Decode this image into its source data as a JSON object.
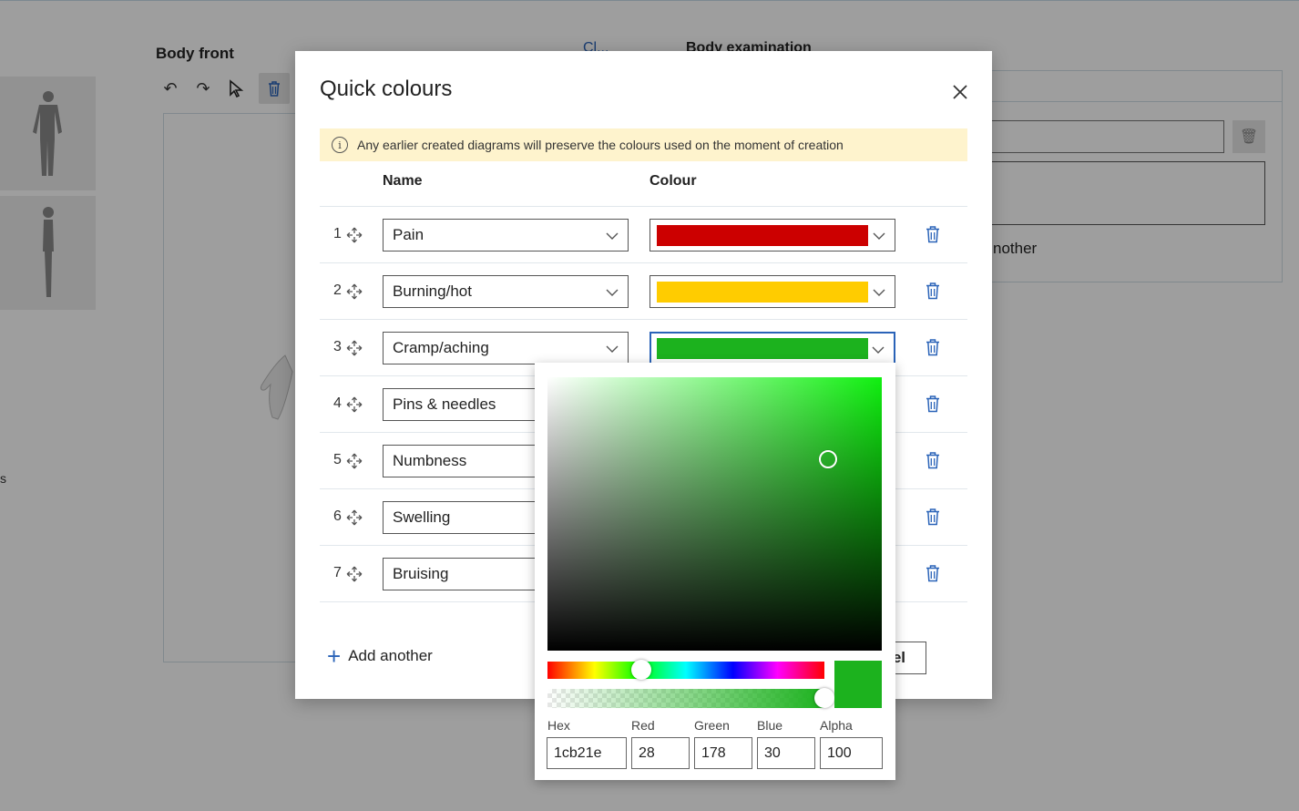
{
  "background": {
    "title": "Body front",
    "faded_header_left": "Cl...",
    "faded_header_right": "Body examination",
    "right_panel_link": "nother",
    "left_edge_char": "s"
  },
  "modal": {
    "title": "Quick colours",
    "notice": "Any earlier created diagrams will preserve the colours used on the moment of creation",
    "col_name": "Name",
    "col_colour": "Colour",
    "rows": [
      {
        "num": "1",
        "name": "Pain",
        "colour": "#cc0000"
      },
      {
        "num": "2",
        "name": "Burning/hot",
        "colour": "#ffcc00"
      },
      {
        "num": "3",
        "name": "Cramp/aching",
        "colour": "#1cb21e"
      },
      {
        "num": "4",
        "name": "Pins & needles",
        "colour": ""
      },
      {
        "num": "5",
        "name": "Numbness",
        "colour": ""
      },
      {
        "num": "6",
        "name": "Swelling",
        "colour": ""
      },
      {
        "num": "7",
        "name": "Bruising",
        "colour": ""
      }
    ],
    "add_another": "Add another",
    "cancel_visible": "el"
  },
  "picker": {
    "base_hue_color": "#10f010",
    "current_color": "#1cb21e",
    "saturation": 0.84,
    "value": 0.7,
    "hue": 0.34,
    "alpha_level": 1.0,
    "labels": {
      "hex": "Hex",
      "red": "Red",
      "green": "Green",
      "blue": "Blue",
      "alpha": "Alpha"
    },
    "values": {
      "hex": "1cb21e",
      "red": "28",
      "green": "178",
      "blue": "30",
      "alpha": "100"
    }
  }
}
